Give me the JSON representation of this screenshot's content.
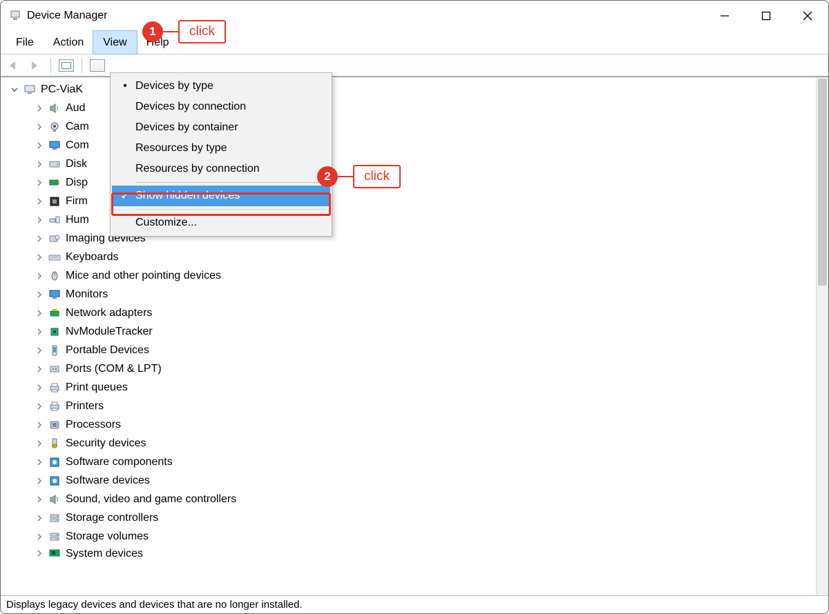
{
  "window": {
    "title": "Device Manager"
  },
  "menubar": {
    "items": [
      "File",
      "Action",
      "View",
      "Help"
    ],
    "active_index": 2
  },
  "dropdown": {
    "items": [
      {
        "label": "Devices by type",
        "mark": "dot",
        "selected": false
      },
      {
        "label": "Devices by connection",
        "mark": "",
        "selected": false
      },
      {
        "label": "Devices by container",
        "mark": "",
        "selected": false
      },
      {
        "label": "Resources by type",
        "mark": "",
        "selected": false
      },
      {
        "label": "Resources by connection",
        "mark": "",
        "selected": false
      },
      {
        "sep": true
      },
      {
        "label": "Show hidden devices",
        "mark": "check",
        "selected": true
      },
      {
        "sep": true
      },
      {
        "label": "Customize...",
        "mark": "",
        "selected": false
      }
    ]
  },
  "tree": {
    "root": {
      "label": "PC-ViaK",
      "expanded": true
    },
    "children": [
      {
        "label": "Aud",
        "truncated": true,
        "icon": "speaker-icon"
      },
      {
        "label": "Cam",
        "truncated": true,
        "icon": "camera-icon"
      },
      {
        "label": "Com",
        "truncated": true,
        "icon": "monitor-icon"
      },
      {
        "label": "Disk",
        "truncated": true,
        "icon": "disk-icon"
      },
      {
        "label": "Disp",
        "truncated": true,
        "icon": "display-adapter-icon"
      },
      {
        "label": "Firm",
        "truncated": true,
        "icon": "firmware-icon"
      },
      {
        "label": "Hum",
        "truncated": true,
        "icon": "hid-icon"
      },
      {
        "label": "Imaging devices",
        "icon": "imaging-icon"
      },
      {
        "label": "Keyboards",
        "icon": "keyboard-icon"
      },
      {
        "label": "Mice and other pointing devices",
        "icon": "mouse-icon"
      },
      {
        "label": "Monitors",
        "icon": "monitor-icon"
      },
      {
        "label": "Network adapters",
        "icon": "network-icon"
      },
      {
        "label": "NvModuleTracker",
        "icon": "chip-icon"
      },
      {
        "label": "Portable Devices",
        "icon": "portable-icon"
      },
      {
        "label": "Ports (COM & LPT)",
        "icon": "port-icon"
      },
      {
        "label": "Print queues",
        "icon": "printer-icon"
      },
      {
        "label": "Printers",
        "icon": "printer-icon"
      },
      {
        "label": "Processors",
        "icon": "cpu-icon"
      },
      {
        "label": "Security devices",
        "icon": "security-icon"
      },
      {
        "label": "Software components",
        "icon": "software-icon"
      },
      {
        "label": "Software devices",
        "icon": "software-icon"
      },
      {
        "label": "Sound, video and game controllers",
        "icon": "speaker-icon"
      },
      {
        "label": "Storage controllers",
        "icon": "storage-icon"
      },
      {
        "label": "Storage volumes",
        "icon": "storage-icon"
      },
      {
        "label": "System devices",
        "icon": "system-icon",
        "clipped": true
      }
    ]
  },
  "statusbar": {
    "text": "Displays legacy devices and devices that are no longer installed."
  },
  "annotations": {
    "step1": {
      "num": "1",
      "label": "click"
    },
    "step2": {
      "num": "2",
      "label": "click"
    }
  }
}
